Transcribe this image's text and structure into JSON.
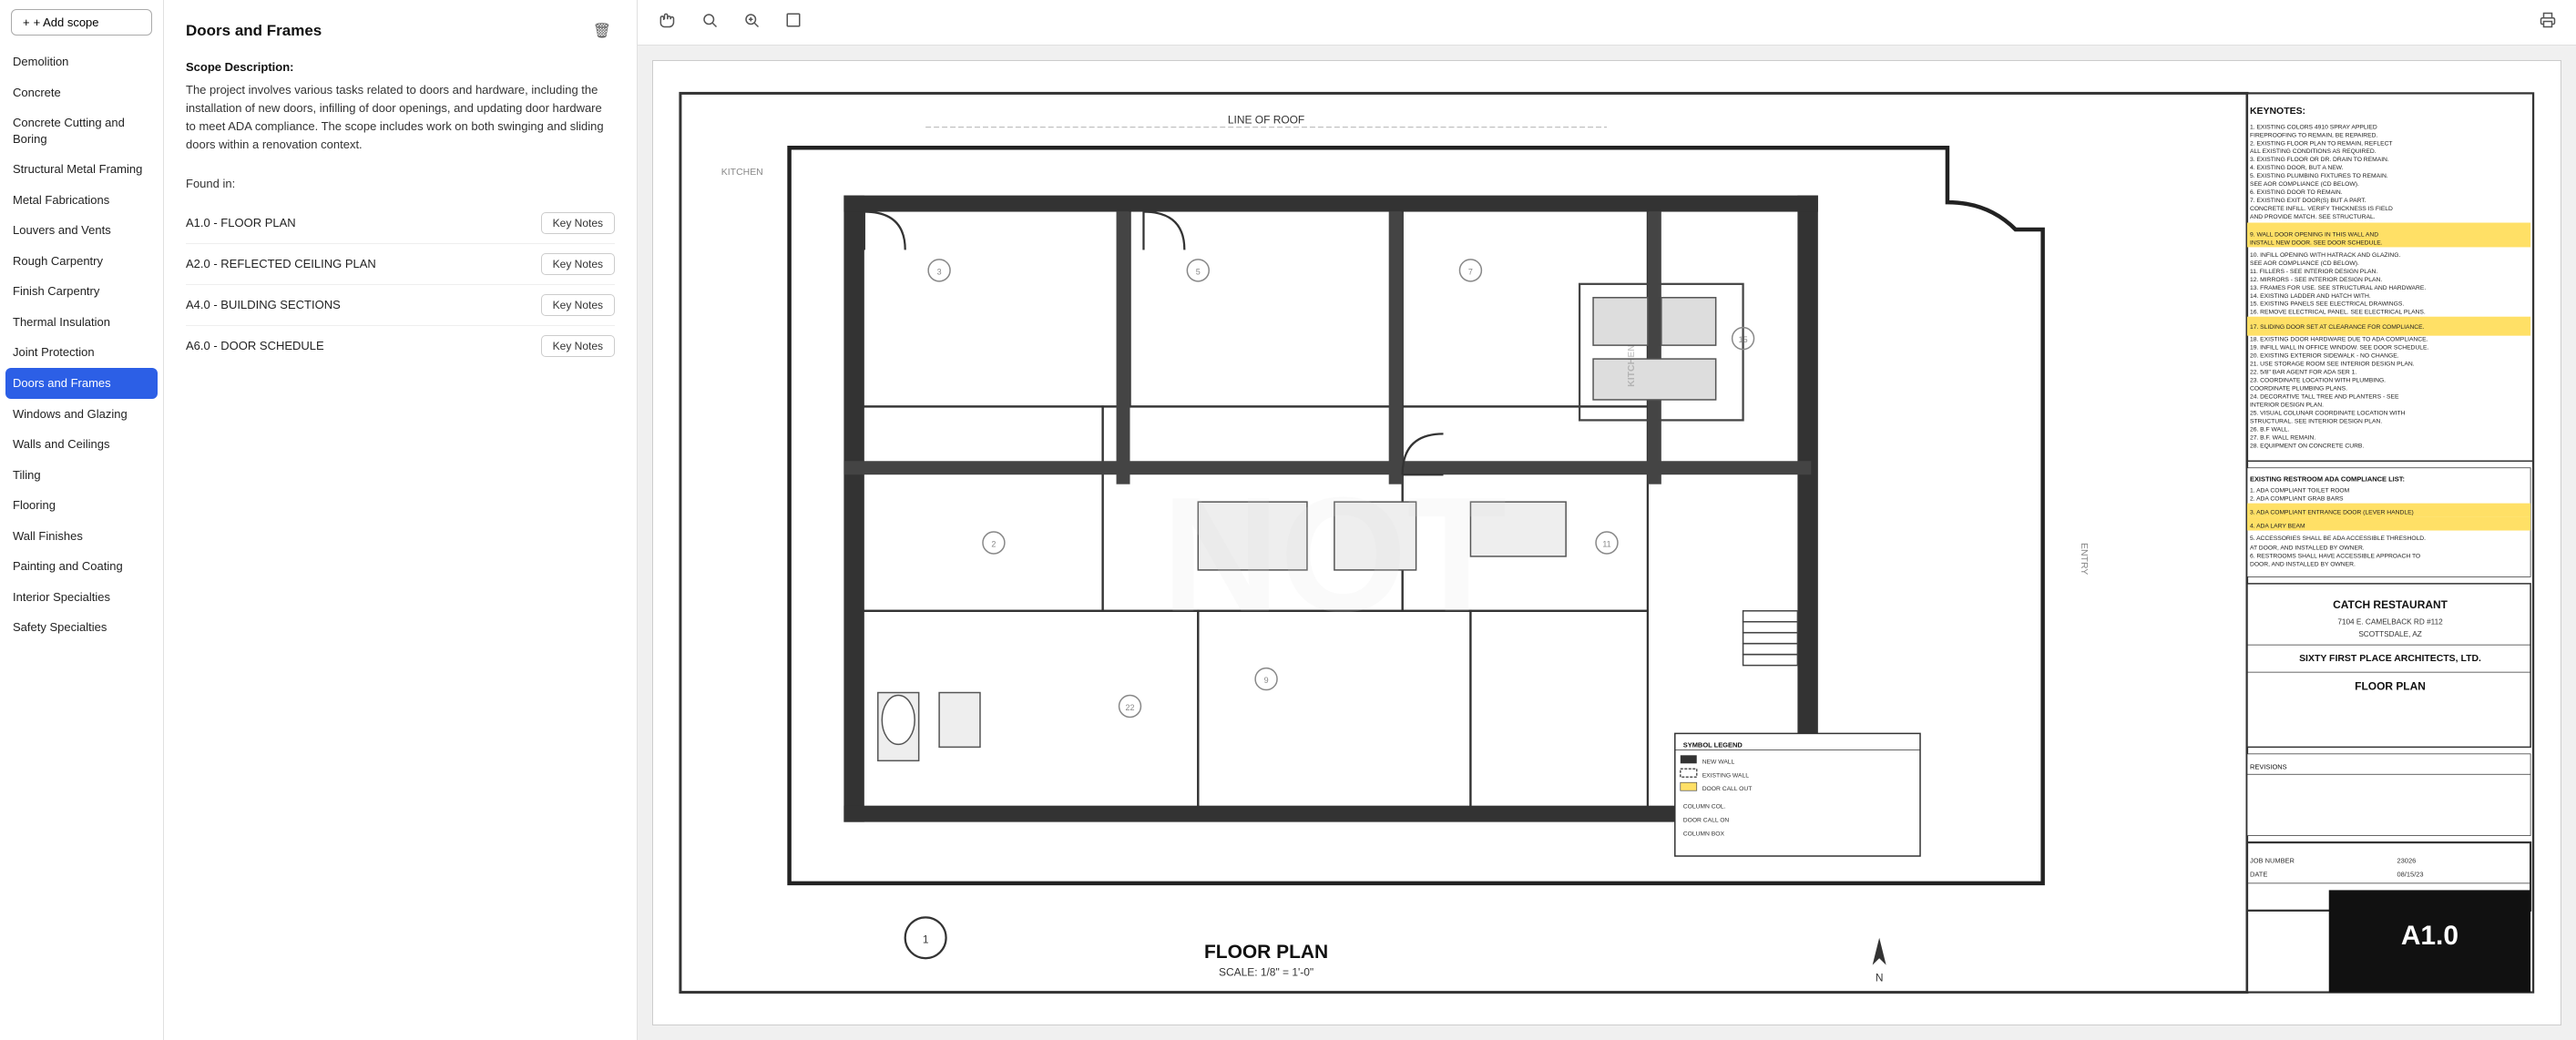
{
  "sidebar": {
    "add_scope_label": "+ Add scope",
    "items": [
      {
        "label": "Demolition",
        "active": false
      },
      {
        "label": "Concrete",
        "active": false
      },
      {
        "label": "Concrete Cutting and Boring",
        "active": false
      },
      {
        "label": "Structural Metal Framing",
        "active": false
      },
      {
        "label": "Metal Fabrications",
        "active": false
      },
      {
        "label": "Louvers and Vents",
        "active": false
      },
      {
        "label": "Rough Carpentry",
        "active": false
      },
      {
        "label": "Finish Carpentry",
        "active": false
      },
      {
        "label": "Thermal Insulation",
        "active": false
      },
      {
        "label": "Joint Protection",
        "active": false
      },
      {
        "label": "Doors and Frames",
        "active": true
      },
      {
        "label": "Windows and Glazing",
        "active": false
      },
      {
        "label": "Walls and Ceilings",
        "active": false
      },
      {
        "label": "Tiling",
        "active": false
      },
      {
        "label": "Flooring",
        "active": false
      },
      {
        "label": "Wall Finishes",
        "active": false
      },
      {
        "label": "Painting and Coating",
        "active": false
      },
      {
        "label": "Interior Specialties",
        "active": false
      },
      {
        "label": "Safety Specialties",
        "active": false
      }
    ]
  },
  "main": {
    "title": "Doors and Frames",
    "scope_description_label": "Scope Description:",
    "scope_description": "The project involves various tasks related to doors and hardware, including the installation of new doors, infilling of door openings, and updating door hardware to meet ADA compliance. The scope includes work on both swinging and sliding doors within a renovation context.",
    "found_in_label": "Found in:",
    "found_items": [
      {
        "name": "A1.0 - FLOOR PLAN",
        "button": "Key Notes"
      },
      {
        "name": "A2.0 - REFLECTED CEILING PLAN",
        "button": "Key Notes"
      },
      {
        "name": "A4.0 - BUILDING SECTIONS",
        "button": "Key Notes"
      },
      {
        "name": "A6.0 - DOOR SCHEDULE",
        "button": "Key Notes"
      }
    ]
  },
  "toolbar": {
    "icons": {
      "hand": "✋",
      "search": "🔍",
      "zoom_in": "🔎",
      "fullscreen": "⬜",
      "print": "🖨"
    }
  },
  "blueprint": {
    "floor_plan_label": "FLOOR PLAN",
    "scale_label": "SCALE: 1/8\" = 1'-0\"",
    "sheet_label": "A1.0",
    "project_name": "CATCH RESTAURANT",
    "address": "7104 E. CAMELBACK RD #112, SCOTTSDALE, AZ",
    "firm_name": "SIXTY FIRST PLACE ARCHITECTS, LTD.",
    "drawing_number": "23026",
    "date": "08/15/23",
    "keynotes_title": "KEYNOTES:"
  }
}
